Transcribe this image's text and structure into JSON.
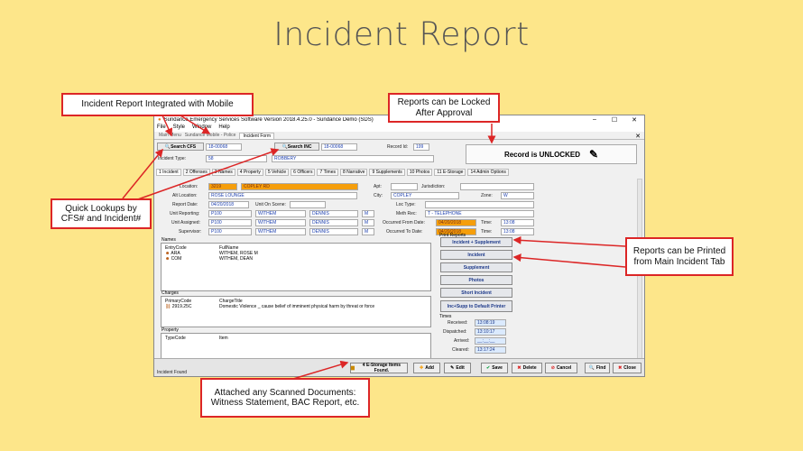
{
  "slide_title": "Incident Report",
  "window": {
    "title": "Sundance Emergency Services Software Version 2018.4.25.0 - Sundance Demo (SDS)",
    "menu": [
      "File",
      "Style",
      "Window",
      "Help"
    ],
    "nav_tabs": [
      "Main Menu",
      "Sundance Mobile - Police",
      "Incident Form"
    ],
    "search_cfs_label": "Search CFS",
    "cfs_value": "18-00068",
    "search_inc_label": "Search INC",
    "inc_value": "18-00068",
    "record_id_label": "Record Id:",
    "record_id_value": "199",
    "incident_type_label": "Incident Type:",
    "incident_type_code": "58",
    "incident_type_desc": "ROBBERY",
    "record_status": "Record is UNLOCKED",
    "tabs": [
      "1 Incident",
      "2 Offenses",
      "3 Names",
      "4 Property",
      "5 Vehicle",
      "6 Officers",
      "7 Times",
      "8 Narrative",
      "9 Supplements",
      "10 Photos",
      "11 E-Storage",
      "14 Admin Options"
    ],
    "location_label": "Location:",
    "location_num": "3219",
    "location_street": "COPLEY RD",
    "apt_label": "Apt:",
    "jurisdiction_label": "Jurisdiction:",
    "alt_location_label": "Alt Location:",
    "alt_location_value": "ROSE LOUNGE",
    "city_label": "City:",
    "city_value": "COPLEY",
    "zone_label": "Zone:",
    "zone_value": "W",
    "report_date_label": "Report Date:",
    "report_date_value": "04/20/2018",
    "unit_on_scene_label": "Unit On Scene:",
    "loc_type_label": "Loc Type:",
    "unit_reporting_label": "Unit Reporting:",
    "unit_reporting": "P100",
    "unit_assigned_label": "Unit Assigned:",
    "unit_assigned": "P100",
    "supervisor_label": "Supervisor:",
    "supervisor": "P100",
    "officer_last": "WITHEM",
    "officer_first": "DENNIS",
    "officer_mi": "M",
    "meth_rec_label": "Meth Rec:",
    "meth_rec_value": "T - TELEPHONE",
    "occurred_from_label": "Occurred From Date:",
    "occurred_from_value": "04/20/2018",
    "occurred_to_label": "Occurred To Date:",
    "occurred_to_value": "04/20/2018",
    "time_label": "Time:",
    "time_value": "13:08",
    "names_header": "Names",
    "names_col1": "EntryCode",
    "names_col2": "FullName",
    "names_rows": [
      {
        "code": "ARA",
        "name": "WITHEM, ROSE M"
      },
      {
        "code": "COM",
        "name": "WITHEM, DEAN"
      }
    ],
    "charges_header": "Charges",
    "charges_col1": "PrimaryCode",
    "charges_col2": "ChargeTitle",
    "charges_row_code": "2919.25C",
    "charges_row_title": "Domestic Violence _ cause belief of imminent physical harm by threat or force",
    "property_header": "Property",
    "property_col1": "TypeCode",
    "property_col2": "Item",
    "print_reports_header": "Print Reports",
    "print_buttons": [
      "Incident + Supplement",
      "Incident",
      "Supplement",
      "Photos",
      "Short Incident",
      "Inc+Supp to Default Printer"
    ],
    "times_header": "Times",
    "times": [
      {
        "label": "Received:",
        "value": "13:08:19"
      },
      {
        "label": "Dispatched:",
        "value": "13:10:17"
      },
      {
        "label": "Arrived:",
        "value": "__:__:__"
      },
      {
        "label": "Cleared:",
        "value": "13:17:24"
      }
    ],
    "status_text": "Incident Found",
    "estorage_label": "4 E-Storage Items Found.",
    "bottom_buttons": [
      "Add",
      "Edit",
      "Save",
      "Delete",
      "Cancel",
      "Find",
      "Close"
    ]
  },
  "callouts": {
    "integrated": "Incident Report Integrated  with Mobile",
    "locked": "Reports can be Locked After Approval",
    "lookups": "Quick Lookups by CFS# and Incident#",
    "printed": "Reports can be Printed from Main Incident Tab",
    "attached": "Attached any Scanned Documents: Witness Statement, BAC Report, etc."
  },
  "colors": {
    "background": "#fde68a",
    "callout_border": "#dc2626",
    "orange_field": "#f59e0b"
  }
}
